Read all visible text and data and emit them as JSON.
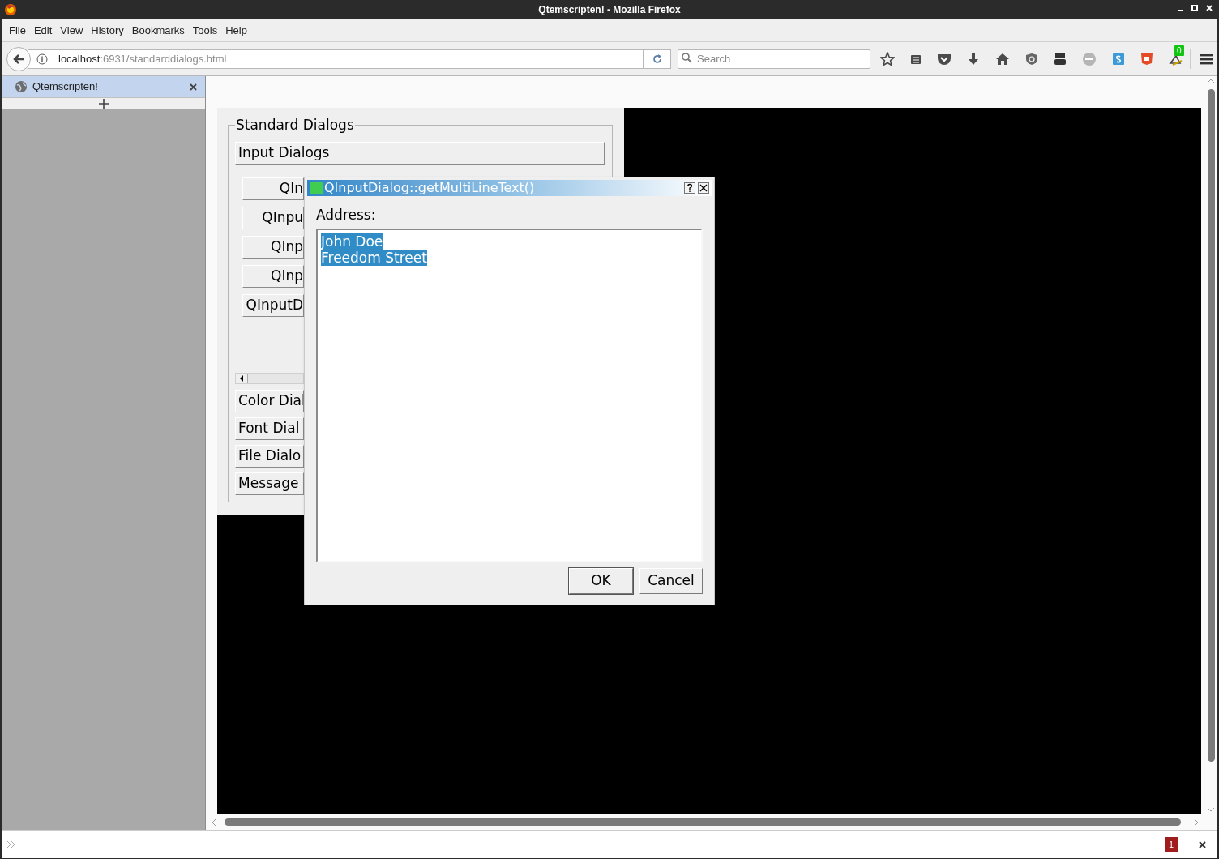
{
  "window": {
    "title": "Qtemscripten! - Mozilla Firefox"
  },
  "menu": [
    "File",
    "Edit",
    "View",
    "History",
    "Bookmarks",
    "Tools",
    "Help"
  ],
  "address_bar": {
    "host": "localhost",
    "path": ":6931/standarddialogs.html"
  },
  "search": {
    "placeholder": "Search"
  },
  "toolbar": {
    "badge": "0"
  },
  "sidebar": {
    "tabs": [
      {
        "label": "Qtemscripten!",
        "selected": true
      }
    ]
  },
  "app": {
    "group_title": "Standard Dialogs",
    "section": "Input Dialogs",
    "input_buttons": [
      "QIn",
      "QInpu",
      "QInp",
      "QInp",
      "QInputD"
    ],
    "sections": [
      "Color Dial",
      "Font Dial",
      "File Dialo",
      "Message"
    ]
  },
  "dialog": {
    "title": "QInputDialog::getMultiLineText()",
    "label": "Address:",
    "lines": [
      {
        "text": "John Doe",
        "selected": true
      },
      {
        "text": "Freedom Street",
        "selected": true
      }
    ],
    "buttons": [
      "OK",
      "Cancel"
    ]
  },
  "status": {
    "badge": "1"
  }
}
